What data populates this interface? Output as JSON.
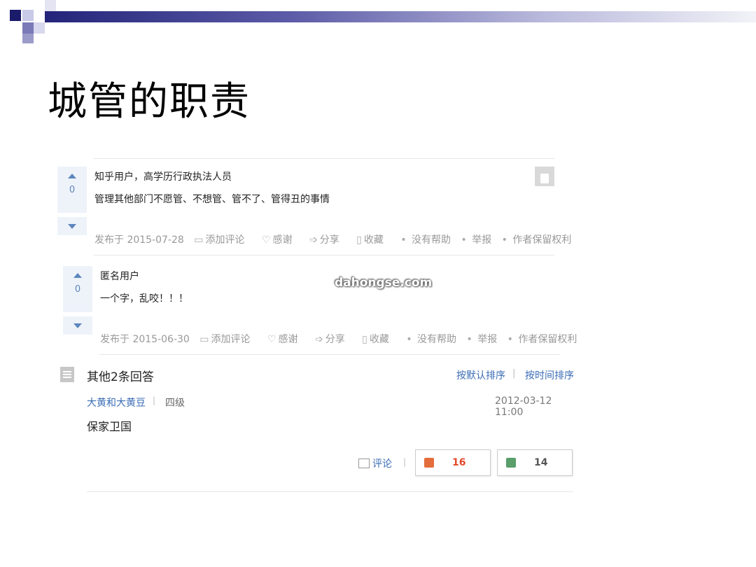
{
  "slide": {
    "title": "城管的职责"
  },
  "watermark": "dahongse.com",
  "answers": [
    {
      "votes": "0",
      "author": "知乎用户，高学历行政执法人员",
      "content": "管理其他部门不愿管、不想管、管不了、管得丑的事情",
      "meta": {
        "published": "发布于 2015-07-28",
        "comment": "添加评论",
        "thanks": "感谢",
        "share": "分享",
        "collect": "收藏",
        "unhelpful": "没有帮助",
        "report": "举报",
        "copyright": "作者保留权利"
      }
    },
    {
      "votes": "0",
      "author": "匿名用户",
      "content": "一个字，乱咬！！！",
      "meta": {
        "published": "发布于 2015-06-30",
        "comment": "添加评论",
        "thanks": "感谢",
        "share": "分享",
        "collect": "收藏",
        "unhelpful": "没有帮助",
        "report": "举报",
        "copyright": "作者保留权利"
      }
    }
  ],
  "other_answers": {
    "title": "其他2条回答",
    "sort_default": "按默认排序",
    "sort_time": "按时间排序",
    "answer": {
      "user": "大黄和大黄豆",
      "level": "四级",
      "time": "2012-03-12 11:00",
      "text": "保家卫国",
      "comment": "评论",
      "likes": "16",
      "dislikes": "14"
    }
  },
  "separator": "|",
  "dot": "•"
}
